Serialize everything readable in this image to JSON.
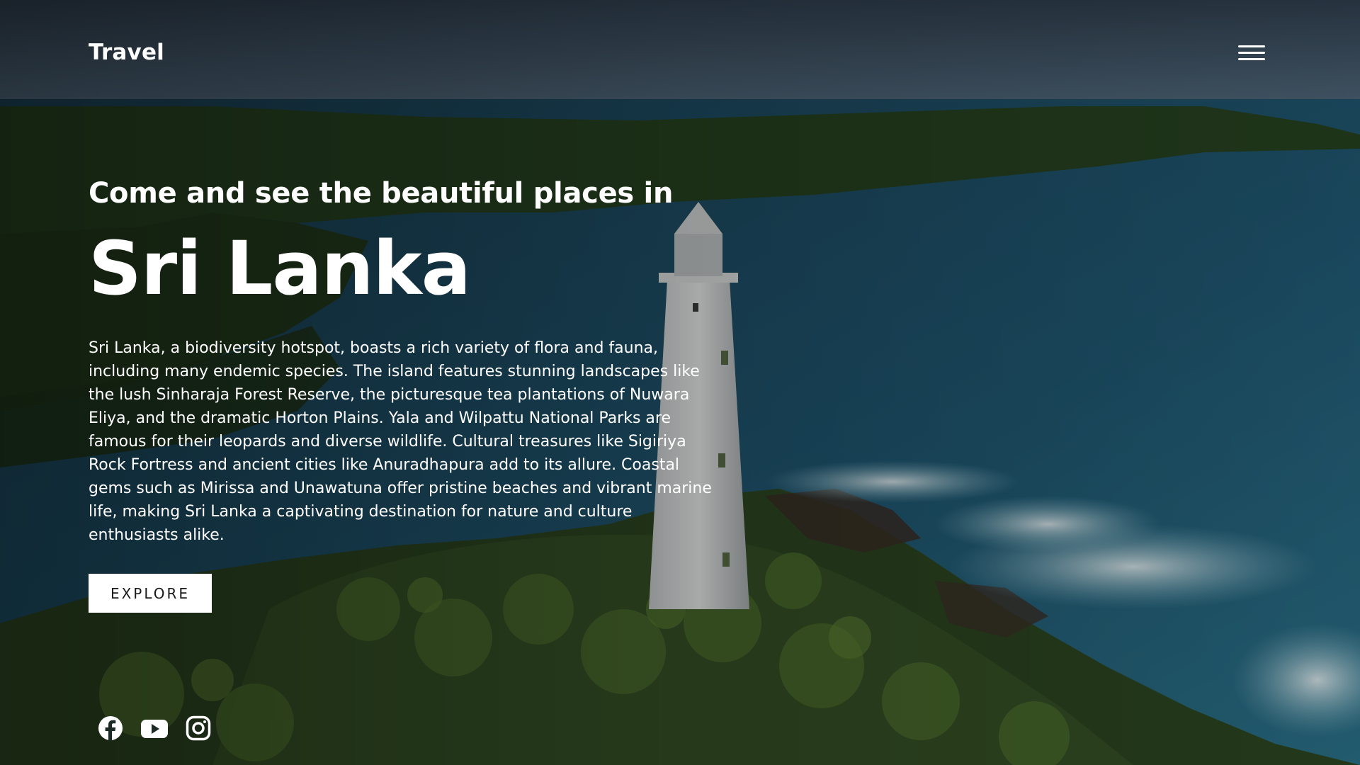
{
  "brand": {
    "logo": "Travel"
  },
  "nav": {
    "menu_icon": "hamburger-menu-icon"
  },
  "hero": {
    "subtitle": "Come and see the beautiful places in",
    "title": "Sri Lanka",
    "description": "Sri Lanka, a biodiversity hotspot, boasts a rich variety of flora and fauna, including many endemic species. The island features stunning landscapes like the lush Sinharaja Forest Reserve, the picturesque tea plantations of Nuwara Eliya, and the dramatic Horton Plains. Yala and Wilpattu National Parks are famous for their leopards and diverse wildlife. Cultural treasures like Sigiriya Rock Fortress and ancient cities like Anuradhapura add to its allure. Coastal gems such as Mirissa and Unawatuna offer pristine beaches and vibrant marine life, making Sri Lanka a captivating destination for nature and culture enthusiasts alike.",
    "cta_label": "EXPLORE"
  },
  "socials": [
    {
      "icon": "facebook-icon"
    },
    {
      "icon": "youtube-icon"
    },
    {
      "icon": "instagram-icon"
    }
  ],
  "colors": {
    "text": "#ffffff",
    "button_bg": "#ffffff",
    "button_text": "#1a1a1a",
    "sea": "#1d4f66",
    "foliage": "#2c4a22",
    "sky": "#3b4d5e"
  }
}
